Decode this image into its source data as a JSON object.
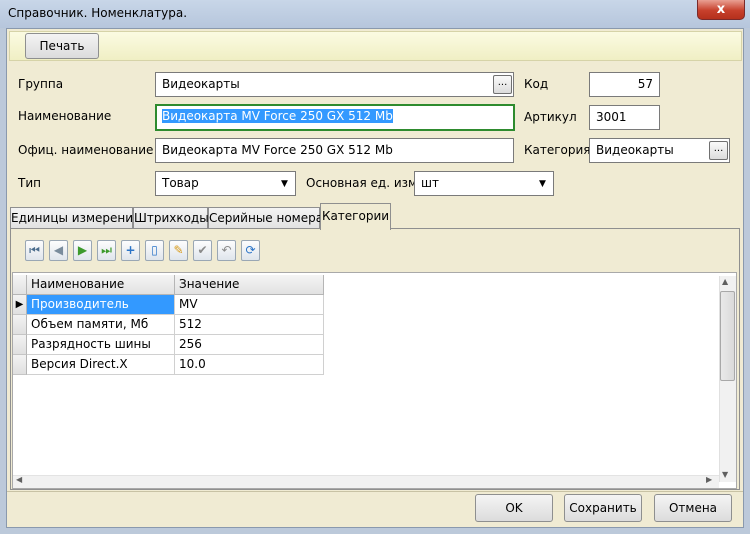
{
  "window": {
    "title": "Справочник. Номенклатура.",
    "close_glyph": "x"
  },
  "toolbar": {
    "print_label": "Печать"
  },
  "form": {
    "group_label": "Группа",
    "group_value": "Видеокарты",
    "select_button": "...",
    "code_label": "Код",
    "code_value": "57",
    "name_label": "Наименование",
    "name_value": "Видеокарта MV Force 250 GX 512 Mb",
    "article_label": "Артикул",
    "article_value": "3001",
    "official_name_label": "Офиц. наименование",
    "official_name_value": "Видеокарта MV Force 250 GX 512 Mb",
    "category_label": "Категория",
    "category_value": "Видеокарты",
    "type_label": "Тип",
    "type_value": "Товар",
    "unit_label": "Основная ед. изм.",
    "unit_value": "шт"
  },
  "tabs": [
    {
      "label": "Единицы измерения",
      "active": false
    },
    {
      "label": "Штрихкоды",
      "active": false
    },
    {
      "label": "Серийные номера",
      "active": false
    },
    {
      "label": "Категории",
      "active": true
    }
  ],
  "grid_toolbar": {
    "icons": [
      "first-record-icon",
      "prev-record-icon",
      "next-record-icon",
      "last-record-icon",
      "add-record-icon",
      "delete-record-icon",
      "edit-record-icon",
      "post-record-icon",
      "cancel-record-icon",
      "refresh-icon"
    ]
  },
  "grid": {
    "columns": [
      "Наименование",
      "Значение"
    ],
    "rows": [
      {
        "name": "Производитель",
        "value": "MV",
        "selected": true
      },
      {
        "name": "Объем памяти, Мб",
        "value": "512",
        "selected": false
      },
      {
        "name": "Разрядность шины",
        "value": "256",
        "selected": false
      },
      {
        "name": "Версия Direct.X",
        "value": "10.0",
        "selected": false
      }
    ]
  },
  "footer": {
    "ok_label": "OK",
    "save_label": "Сохранить",
    "cancel_label": "Отмена"
  },
  "colors": {
    "window_bg": "#f0ebd3",
    "selection": "#3399ff",
    "focus_border": "#2e8b2e",
    "close_button": "#c7402c"
  }
}
